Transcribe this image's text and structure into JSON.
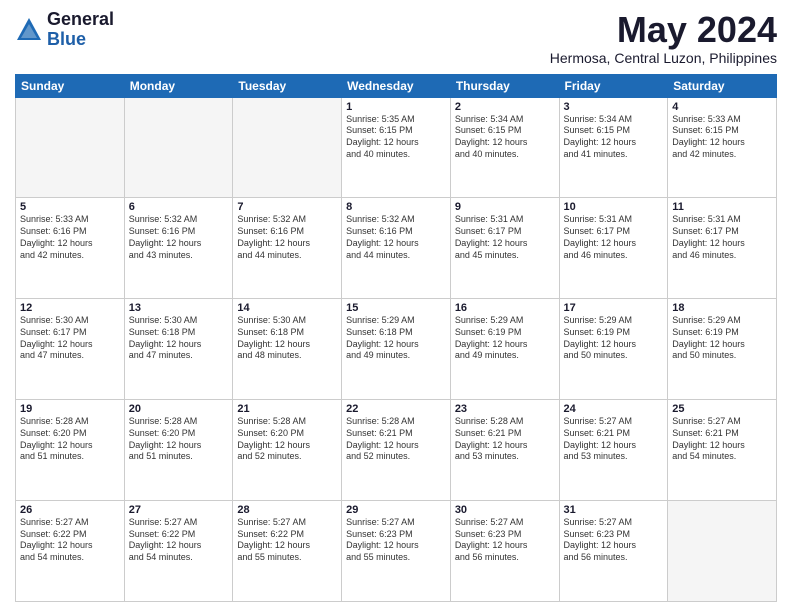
{
  "logo": {
    "general": "General",
    "blue": "Blue"
  },
  "title": "May 2024",
  "subtitle": "Hermosa, Central Luzon, Philippines",
  "days_of_week": [
    "Sunday",
    "Monday",
    "Tuesday",
    "Wednesday",
    "Thursday",
    "Friday",
    "Saturday"
  ],
  "weeks": [
    [
      {
        "day": "",
        "info": ""
      },
      {
        "day": "",
        "info": ""
      },
      {
        "day": "",
        "info": ""
      },
      {
        "day": "1",
        "info": "Sunrise: 5:35 AM\nSunset: 6:15 PM\nDaylight: 12 hours\nand 40 minutes."
      },
      {
        "day": "2",
        "info": "Sunrise: 5:34 AM\nSunset: 6:15 PM\nDaylight: 12 hours\nand 40 minutes."
      },
      {
        "day": "3",
        "info": "Sunrise: 5:34 AM\nSunset: 6:15 PM\nDaylight: 12 hours\nand 41 minutes."
      },
      {
        "day": "4",
        "info": "Sunrise: 5:33 AM\nSunset: 6:15 PM\nDaylight: 12 hours\nand 42 minutes."
      }
    ],
    [
      {
        "day": "5",
        "info": "Sunrise: 5:33 AM\nSunset: 6:16 PM\nDaylight: 12 hours\nand 42 minutes."
      },
      {
        "day": "6",
        "info": "Sunrise: 5:32 AM\nSunset: 6:16 PM\nDaylight: 12 hours\nand 43 minutes."
      },
      {
        "day": "7",
        "info": "Sunrise: 5:32 AM\nSunset: 6:16 PM\nDaylight: 12 hours\nand 44 minutes."
      },
      {
        "day": "8",
        "info": "Sunrise: 5:32 AM\nSunset: 6:16 PM\nDaylight: 12 hours\nand 44 minutes."
      },
      {
        "day": "9",
        "info": "Sunrise: 5:31 AM\nSunset: 6:17 PM\nDaylight: 12 hours\nand 45 minutes."
      },
      {
        "day": "10",
        "info": "Sunrise: 5:31 AM\nSunset: 6:17 PM\nDaylight: 12 hours\nand 46 minutes."
      },
      {
        "day": "11",
        "info": "Sunrise: 5:31 AM\nSunset: 6:17 PM\nDaylight: 12 hours\nand 46 minutes."
      }
    ],
    [
      {
        "day": "12",
        "info": "Sunrise: 5:30 AM\nSunset: 6:17 PM\nDaylight: 12 hours\nand 47 minutes."
      },
      {
        "day": "13",
        "info": "Sunrise: 5:30 AM\nSunset: 6:18 PM\nDaylight: 12 hours\nand 47 minutes."
      },
      {
        "day": "14",
        "info": "Sunrise: 5:30 AM\nSunset: 6:18 PM\nDaylight: 12 hours\nand 48 minutes."
      },
      {
        "day": "15",
        "info": "Sunrise: 5:29 AM\nSunset: 6:18 PM\nDaylight: 12 hours\nand 49 minutes."
      },
      {
        "day": "16",
        "info": "Sunrise: 5:29 AM\nSunset: 6:19 PM\nDaylight: 12 hours\nand 49 minutes."
      },
      {
        "day": "17",
        "info": "Sunrise: 5:29 AM\nSunset: 6:19 PM\nDaylight: 12 hours\nand 50 minutes."
      },
      {
        "day": "18",
        "info": "Sunrise: 5:29 AM\nSunset: 6:19 PM\nDaylight: 12 hours\nand 50 minutes."
      }
    ],
    [
      {
        "day": "19",
        "info": "Sunrise: 5:28 AM\nSunset: 6:20 PM\nDaylight: 12 hours\nand 51 minutes."
      },
      {
        "day": "20",
        "info": "Sunrise: 5:28 AM\nSunset: 6:20 PM\nDaylight: 12 hours\nand 51 minutes."
      },
      {
        "day": "21",
        "info": "Sunrise: 5:28 AM\nSunset: 6:20 PM\nDaylight: 12 hours\nand 52 minutes."
      },
      {
        "day": "22",
        "info": "Sunrise: 5:28 AM\nSunset: 6:21 PM\nDaylight: 12 hours\nand 52 minutes."
      },
      {
        "day": "23",
        "info": "Sunrise: 5:28 AM\nSunset: 6:21 PM\nDaylight: 12 hours\nand 53 minutes."
      },
      {
        "day": "24",
        "info": "Sunrise: 5:27 AM\nSunset: 6:21 PM\nDaylight: 12 hours\nand 53 minutes."
      },
      {
        "day": "25",
        "info": "Sunrise: 5:27 AM\nSunset: 6:21 PM\nDaylight: 12 hours\nand 54 minutes."
      }
    ],
    [
      {
        "day": "26",
        "info": "Sunrise: 5:27 AM\nSunset: 6:22 PM\nDaylight: 12 hours\nand 54 minutes."
      },
      {
        "day": "27",
        "info": "Sunrise: 5:27 AM\nSunset: 6:22 PM\nDaylight: 12 hours\nand 54 minutes."
      },
      {
        "day": "28",
        "info": "Sunrise: 5:27 AM\nSunset: 6:22 PM\nDaylight: 12 hours\nand 55 minutes."
      },
      {
        "day": "29",
        "info": "Sunrise: 5:27 AM\nSunset: 6:23 PM\nDaylight: 12 hours\nand 55 minutes."
      },
      {
        "day": "30",
        "info": "Sunrise: 5:27 AM\nSunset: 6:23 PM\nDaylight: 12 hours\nand 56 minutes."
      },
      {
        "day": "31",
        "info": "Sunrise: 5:27 AM\nSunset: 6:23 PM\nDaylight: 12 hours\nand 56 minutes."
      },
      {
        "day": "",
        "info": ""
      }
    ]
  ]
}
